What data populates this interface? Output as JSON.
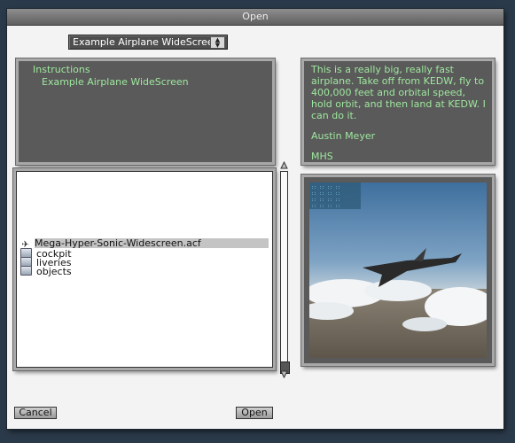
{
  "window": {
    "title": "Open"
  },
  "aircraft_popup": {
    "selected": "Example Airplane WideScreen"
  },
  "instructions": {
    "line1": "Instructions",
    "line2": "Example Airplane WideScreen"
  },
  "description": {
    "paragraphs": [
      "This is a really big, really fast airplane. Take off from KEDW, fly to 400,000 feet and orbital speed, hold orbit, and then land at KEDW. I can do it.",
      "Austin Meyer",
      "MHS"
    ]
  },
  "files": [
    {
      "name": "Mega-Hyper-Sonic-Widescreen.acf",
      "icon": "plane-icon",
      "selected": true
    },
    {
      "name": "cockpit",
      "icon": "folder-icon",
      "selected": false
    },
    {
      "name": "liveries",
      "icon": "folder-icon",
      "selected": false
    },
    {
      "name": "objects",
      "icon": "folder-icon",
      "selected": false
    }
  ],
  "buttons": {
    "cancel": "Cancel",
    "open": "Open"
  },
  "colors": {
    "panel_text": "#9fe89f",
    "panel_bg": "#5a5a5a",
    "selection": "#c4c4c4"
  }
}
